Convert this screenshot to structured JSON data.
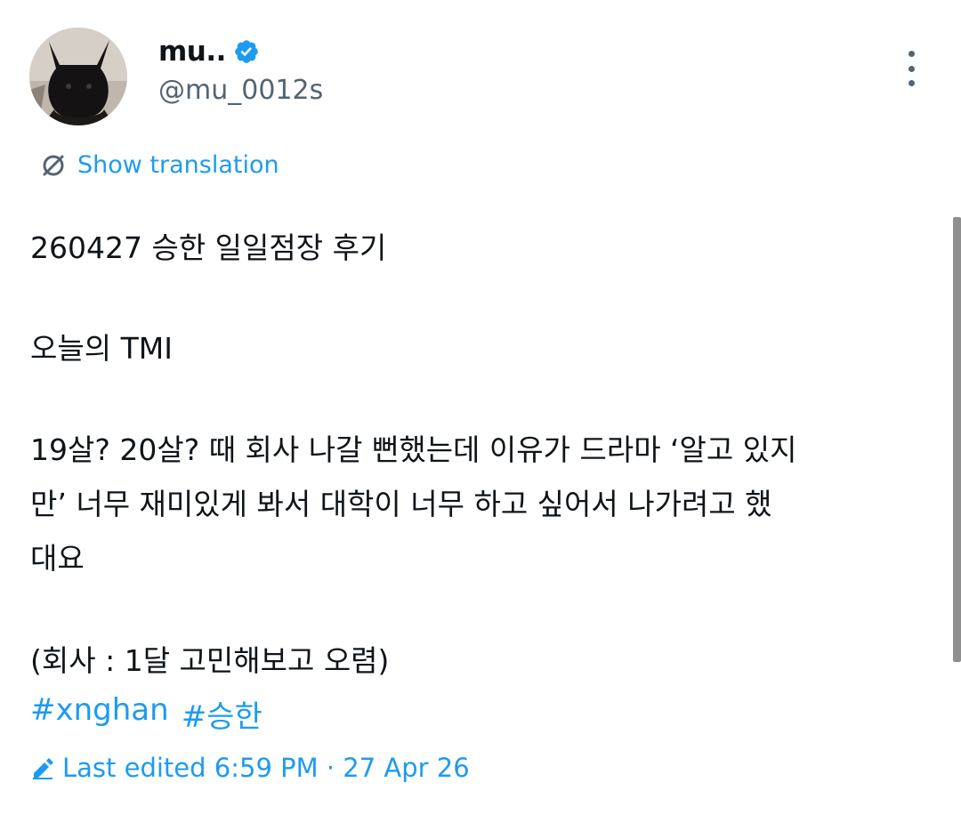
{
  "tweet": {
    "display_name": "mu..",
    "handle": "@mu_0012s",
    "verified_icon": "verified-badge-icon",
    "more_icon": "more-options-icon",
    "show_translation": "Show translation",
    "lines": [
      "260427 승한 일일점장 후기",
      "오늘의 TMI",
      "19살? 20살? 때 회사 나갈 뻔했는데 이유가 드라마 ‘알고 있지",
      "만’ 너무 재미있게 봐서 대학이 너무 하고 싶어서 나가려고 했",
      "대요",
      "(회사 : 1달 고민해보고 오렴)"
    ],
    "hashtags": [
      "#xnghan",
      "#승한"
    ],
    "edited": "Last edited 6:59 PM · 27 Apr 26"
  },
  "colors": {
    "accent": "#1d9bf0",
    "secondary_text": "#536471",
    "primary_text": "#0f1419"
  }
}
